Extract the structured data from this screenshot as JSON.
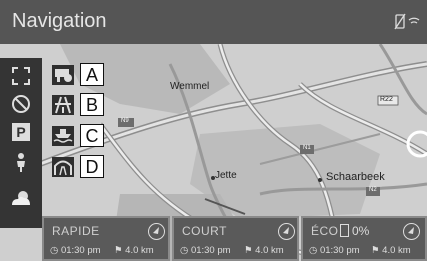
{
  "header": {
    "title": "Navigation",
    "status_icon": "phone-signal-icon"
  },
  "map": {
    "labels": {
      "wemmel": "Wemmel",
      "jette": "Jette",
      "schaarbeek": "Schaarbeek",
      "n9": "N9",
      "n1": "N1",
      "n2": "N2",
      "r22": "R22"
    }
  },
  "sidebar": {
    "items": [
      {
        "icon": "expand-icon"
      },
      {
        "icon": "no-entry-icon"
      },
      {
        "icon": "parking-icon",
        "label": "P"
      },
      {
        "icon": "person-pin-icon"
      },
      {
        "icon": "weather-icon"
      }
    ]
  },
  "route_options": [
    {
      "icon": "toll-icon",
      "letter": "A"
    },
    {
      "icon": "highway-icon",
      "letter": "B"
    },
    {
      "icon": "ferry-icon",
      "letter": "C"
    },
    {
      "icon": "tunnel-icon",
      "letter": "D"
    }
  ],
  "routes": [
    {
      "name": "RAPIDE",
      "time": "01:30 pm",
      "distance": "4.0 km"
    },
    {
      "name": "COURT",
      "time": "01:30 pm",
      "distance": "4.0 km"
    },
    {
      "name": "ÉCO",
      "time": "01:30 pm",
      "distance": "4.0 km",
      "fuel": "0%"
    }
  ]
}
